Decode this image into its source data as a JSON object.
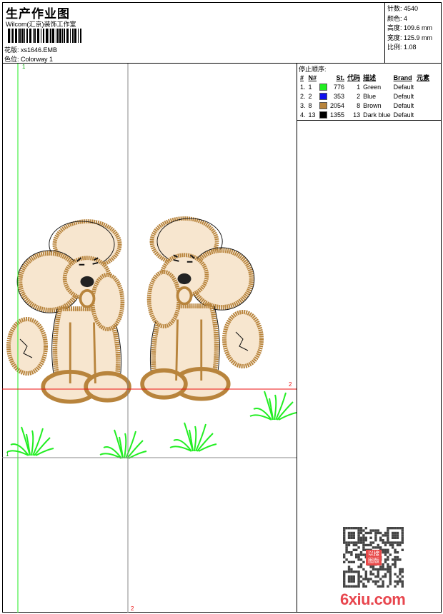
{
  "header": {
    "title": "生产作业图",
    "company": "Wilcom(汇京)装饰工作室",
    "design_label": "花版:",
    "design_value": "xs1646.EMB",
    "colorway_label": "色位:",
    "colorway_value": "Colorway 1"
  },
  "stats": [
    {
      "label": "针数:",
      "value": "4540"
    },
    {
      "label": "颜色:",
      "value": "4"
    },
    {
      "label": "高度:",
      "value": "109.6 mm"
    },
    {
      "label": "宽度:",
      "value": "125.9 mm"
    },
    {
      "label": "比例:",
      "value": "1.08"
    }
  ],
  "stop_sequence": {
    "title": "停止顺序:",
    "headers": [
      "#",
      "N#",
      "St.",
      "代码",
      "描述",
      "Brand",
      "元素"
    ],
    "rows": [
      {
        "idx": "1.",
        "n": "1",
        "color": "#22ee22",
        "st": "776",
        "code": "1",
        "desc": "Green",
        "brand": "Default"
      },
      {
        "idx": "2.",
        "n": "2",
        "color": "#1010ee",
        "st": "353",
        "code": "2",
        "desc": "Blue",
        "brand": "Default"
      },
      {
        "idx": "3.",
        "n": "8",
        "color": "#b8843c",
        "st": "2054",
        "code": "8",
        "desc": "Brown",
        "brand": "Default"
      },
      {
        "idx": "4.",
        "n": "13",
        "color": "#000000",
        "st": "1355",
        "code": "13",
        "desc": "Dark blue",
        "brand": "Default"
      }
    ]
  },
  "guides": {
    "v1": "1",
    "h1": "1",
    "h2": "2",
    "v2": "2"
  },
  "watermark": {
    "text": "6xiu.com",
    "stamp": "以图搜版"
  }
}
